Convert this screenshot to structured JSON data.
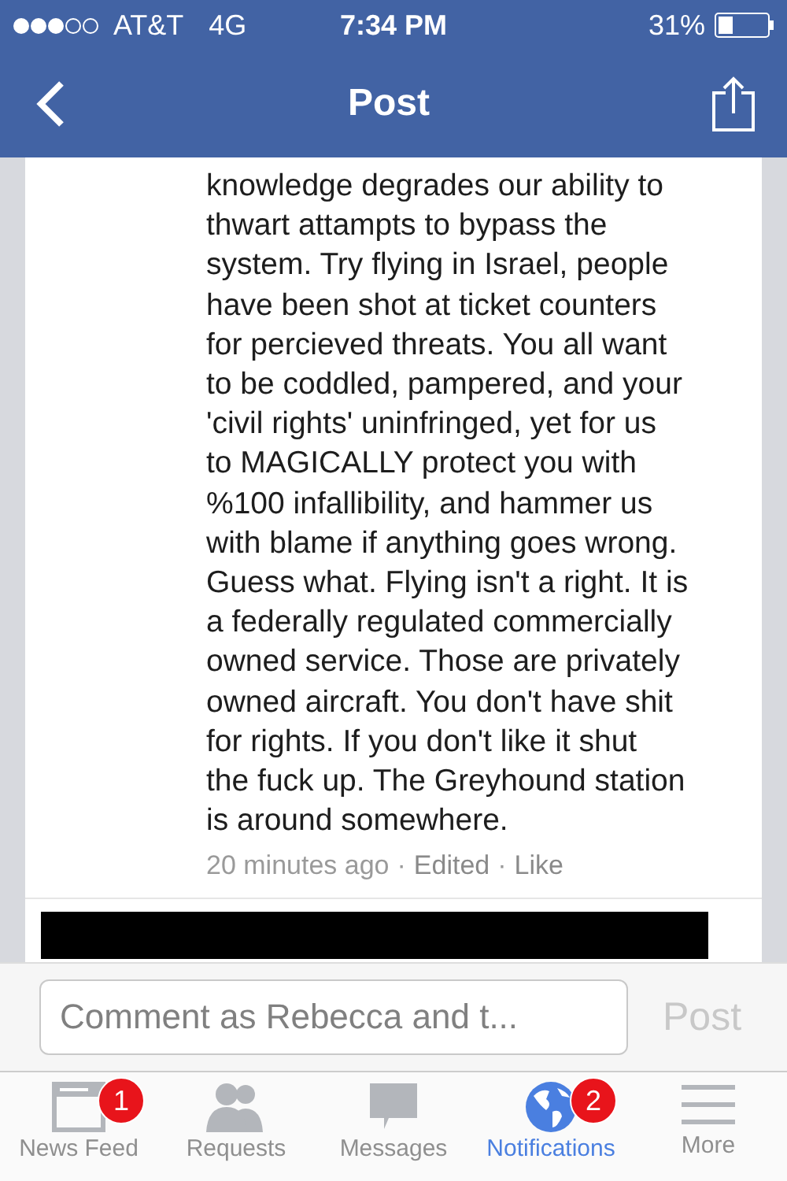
{
  "status_bar": {
    "carrier": "AT&T",
    "network": "4G",
    "time": "7:34 PM",
    "battery": "31%"
  },
  "nav": {
    "title": "Post"
  },
  "comment": {
    "lines": [
      "knowledge degrades our ability to",
      "thwart attampts to bypass the",
      "system. Try flying in Israel, people",
      "have been shot at ticket counters",
      "for percieved threats. You all want",
      "to be coddled, pampered, and your",
      "'civil rights' uninfringed, yet for us",
      "to MAGICALLY protect you with",
      "%100 infallibility, and hammer us",
      "with blame if anything goes wrong.",
      "Guess what. Flying isn't a right. It is",
      "a federally regulated commercially",
      "owned service. Those are privately",
      "owned aircraft. You don't have shit",
      "for rights. If you don't like it shut",
      "the fuck up. The Greyhound station",
      "is around somewhere."
    ],
    "time": "20 minutes ago",
    "separator": "·",
    "edited": "Edited",
    "like": "Like"
  },
  "composer": {
    "placeholder": "Comment as Rebecca and t...",
    "post": "Post",
    "post_disabled": true
  },
  "tabs": [
    {
      "label": "News Feed",
      "kind": "feed",
      "badge": "1",
      "selected": false
    },
    {
      "label": "Requests",
      "kind": "requests",
      "selected": false
    },
    {
      "label": "Messages",
      "kind": "messages",
      "selected": false
    },
    {
      "label": "Notifications",
      "kind": "globe",
      "badge": "2",
      "selected": true
    },
    {
      "label": "More",
      "kind": "more",
      "selected": false
    }
  ]
}
